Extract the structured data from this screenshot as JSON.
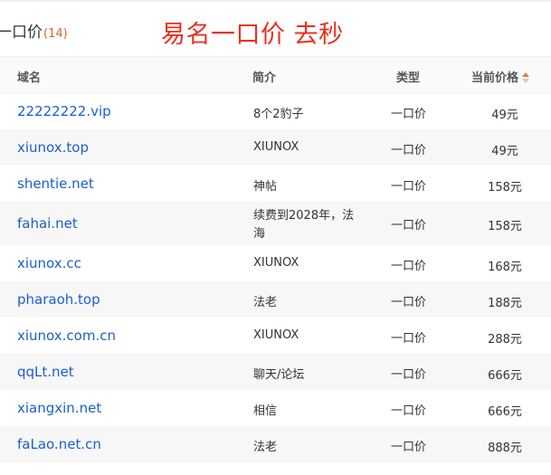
{
  "header": {
    "title": "一口价",
    "count": "(14)",
    "promo": "易名一口价 去秒"
  },
  "table": {
    "columns": {
      "name": "域名",
      "desc": "简介",
      "type": "类型",
      "price": "当前价格"
    },
    "rows": [
      {
        "name": "22222222.vip",
        "desc": "8个2豹子",
        "type": "一口价",
        "price": "49元"
      },
      {
        "name": "xiunox.top",
        "desc": "XIUNOX",
        "type": "一口价",
        "price": "49元"
      },
      {
        "name": "shentie.net",
        "desc": "神帖",
        "type": "一口价",
        "price": "158元"
      },
      {
        "name": "fahai.net",
        "desc": "续费到2028年，法海",
        "type": "一口价",
        "price": "158元"
      },
      {
        "name": "xiunox.cc",
        "desc": "XIUNOX",
        "type": "一口价",
        "price": "168元"
      },
      {
        "name": "pharaoh.top",
        "desc": "法老",
        "type": "一口价",
        "price": "188元"
      },
      {
        "name": "xiunox.com.cn",
        "desc": "XIUNOX",
        "type": "一口价",
        "price": "288元"
      },
      {
        "name": "qqLt.net",
        "desc": "聊天/论坛",
        "type": "一口价",
        "price": "666元"
      },
      {
        "name": "xiangxin.net",
        "desc": "相信",
        "type": "一口价",
        "price": "666元"
      },
      {
        "name": "faLao.net.cn",
        "desc": "法老",
        "type": "一口价",
        "price": "888元"
      }
    ]
  },
  "colors": {
    "link": "#1a5fcc",
    "promo": "#e8311f",
    "count": "#e0622a",
    "sort_active": "#f07a3c"
  },
  "icons": {
    "sort": "sort-ascending-icon"
  }
}
